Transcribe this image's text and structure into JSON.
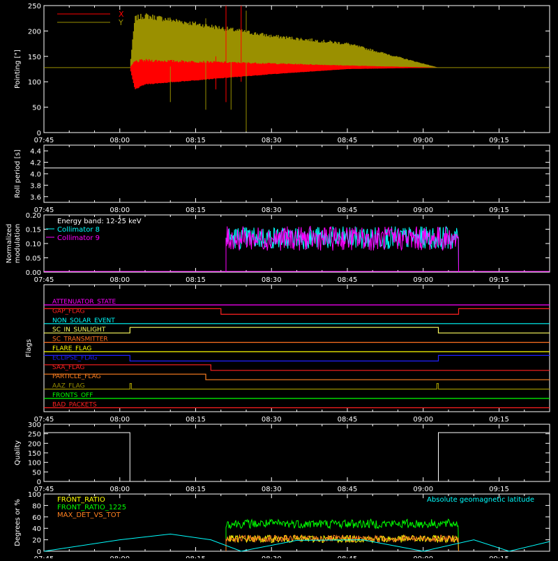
{
  "time_ticks": [
    "07:45",
    "08:00",
    "08:15",
    "08:30",
    "08:45",
    "09:00",
    "09:15"
  ],
  "panels": [
    {
      "id": "pointing",
      "ylabel": "Pointing [\"]",
      "yticks": [
        "0",
        "50",
        "100",
        "150",
        "200",
        "250"
      ],
      "ylim": [
        0,
        250
      ]
    },
    {
      "id": "roll",
      "ylabel": "Roll period [s]",
      "yticks": [
        "3.6",
        "3.8",
        "4.0",
        "4.2",
        "4.4"
      ],
      "ylim": [
        3.5,
        4.5
      ]
    },
    {
      "id": "modulation",
      "ylabel": "Normalized modulation",
      "ylabel_lines": [
        "Normalized",
        "modulation"
      ],
      "yticks": [
        "0.00",
        "0.05",
        "0.10",
        "0.15",
        "0.20"
      ],
      "ylim": [
        0,
        0.2
      ]
    },
    {
      "id": "flags",
      "ylabel": "Flags"
    },
    {
      "id": "quality",
      "ylabel": "Quality",
      "yticks": [
        "0",
        "50",
        "100",
        "150",
        "200",
        "250",
        "300"
      ],
      "ylim": [
        0,
        300
      ]
    },
    {
      "id": "latitude",
      "ylabel": "Degrees or %",
      "yticks": [
        "0",
        "20",
        "40",
        "60",
        "80",
        "100"
      ],
      "ylim": [
        0,
        100
      ]
    }
  ],
  "pointing_legend": [
    {
      "name": "X",
      "color": "#ff0000"
    },
    {
      "name": "Y",
      "color": "#9a9000"
    }
  ],
  "modulation_legend": {
    "title": "Energy band: 12-25 keV",
    "items": [
      {
        "name": "Collimator 8",
        "color": "#00ffff"
      },
      {
        "name": "Collimator 9",
        "color": "#ff00ff"
      }
    ]
  },
  "flags": [
    {
      "name": "ATTENUATOR_STATE",
      "color": "#ff00ff"
    },
    {
      "name": "GAP_FLAG",
      "color": "#ff2020"
    },
    {
      "name": "NON_SOLAR_EVENT",
      "color": "#00ffff"
    },
    {
      "name": "SC_IN_SUNLIGHT",
      "color": "#ffff60"
    },
    {
      "name": "SC_TRANSMITTER",
      "color": "#ff7020"
    },
    {
      "name": "FLARE_FLAG",
      "color": "#ffff00"
    },
    {
      "name": "ECLIPSE_FLAG",
      "color": "#2020ff"
    },
    {
      "name": "SAA_FLAG",
      "color": "#ff2020"
    },
    {
      "name": "PARTICLE_FLAG",
      "color": "#ff8020"
    },
    {
      "name": "AAZ_FLAG",
      "color": "#9a9000"
    },
    {
      "name": "FRONTS_OFF",
      "color": "#00ff00"
    },
    {
      "name": "BAD_PACKETS",
      "color": "#ff2020"
    }
  ],
  "latitude_legend": [
    {
      "name": "FRONT_RATIO",
      "color": "#ffff00"
    },
    {
      "name": "FRONT_RATIO_1225",
      "color": "#00ff00"
    },
    {
      "name": "MAX_DET_VS_TOT",
      "color": "#ff8020"
    }
  ],
  "latitude_label": {
    "text": "Absolute geomagnetic latitude",
    "color": "#00ffff"
  },
  "chart_data": [
    {
      "type": "line",
      "title": "",
      "xlabel": "",
      "ylabel": "Pointing [\"]",
      "xlim": [
        "07:45",
        "09:25"
      ],
      "ylim": [
        0,
        250
      ],
      "series": [
        {
          "name": "X",
          "color": "#ff0000",
          "x": [
            "07:45",
            "08:02",
            "08:03",
            "08:05",
            "08:30",
            "08:45",
            "09:03",
            "09:25"
          ],
          "y_low": [
            128,
            128,
            85,
            95,
            115,
            125,
            128,
            128
          ],
          "y_high": [
            128,
            128,
            140,
            142,
            136,
            132,
            128,
            128
          ]
        },
        {
          "name": "Y",
          "color": "#9a9000",
          "x": [
            "07:45",
            "08:02",
            "08:03",
            "08:05",
            "08:30",
            "08:45",
            "09:03",
            "09:25"
          ],
          "y_low": [
            128,
            128,
            130,
            130,
            128,
            126,
            128,
            128
          ],
          "y_high": [
            128,
            128,
            225,
            230,
            190,
            175,
            128,
            128
          ]
        }
      ]
    },
    {
      "type": "line",
      "title": "",
      "xlabel": "",
      "ylabel": "Roll period [s]",
      "xlim": [
        "07:45",
        "09:25"
      ],
      "ylim": [
        3.5,
        4.5
      ],
      "series": [
        {
          "x": [
            "07:45",
            "09:25"
          ],
          "y": [
            4.1,
            4.1
          ],
          "color": "#ffffff"
        }
      ]
    },
    {
      "type": "line",
      "title": "",
      "xlabel": "",
      "ylabel": "Normalized modulation",
      "xlim": [
        "07:45",
        "09:25"
      ],
      "ylim": [
        0,
        0.2
      ],
      "series": [
        {
          "name": "Collimator 8",
          "color": "#00ffff",
          "x_start": "08:21",
          "x_end": "09:07",
          "mean": 0.105,
          "min": 0.08,
          "max": 0.16
        },
        {
          "name": "Collimator 9",
          "color": "#ff00ff",
          "x_start": "08:21",
          "x_end": "09:07",
          "mean": 0.1,
          "min": 0.075,
          "max": 0.16
        }
      ]
    },
    {
      "type": "line",
      "title": "",
      "xlabel": "",
      "ylabel": "Flags",
      "xlim": [
        "07:45",
        "09:25"
      ],
      "series": [
        {
          "name": "ATTENUATOR_STATE",
          "steps": [
            [
              "07:45",
              0
            ]
          ]
        },
        {
          "name": "GAP_FLAG",
          "steps": [
            [
              "07:45",
              1
            ],
            [
              "08:20",
              0
            ],
            [
              "09:07",
              1
            ]
          ]
        },
        {
          "name": "NON_SOLAR_EVENT",
          "steps": [
            [
              "07:45",
              0
            ]
          ]
        },
        {
          "name": "SC_IN_SUNLIGHT",
          "steps": [
            [
              "07:45",
              0
            ],
            [
              "08:02",
              1
            ],
            [
              "09:03",
              0
            ]
          ]
        },
        {
          "name": "SC_TRANSMITTER",
          "steps": [
            [
              "07:45",
              0
            ]
          ]
        },
        {
          "name": "FLARE_FLAG",
          "steps": [
            [
              "07:45",
              0
            ]
          ]
        },
        {
          "name": "ECLIPSE_FLAG",
          "steps": [
            [
              "07:45",
              1
            ],
            [
              "08:02",
              0
            ],
            [
              "09:03",
              1
            ]
          ]
        },
        {
          "name": "SAA_FLAG",
          "steps": [
            [
              "07:45",
              1
            ],
            [
              "08:18",
              0
            ]
          ]
        },
        {
          "name": "PARTICLE_FLAG",
          "steps": [
            [
              "07:45",
              1
            ],
            [
              "08:17",
              0
            ]
          ]
        },
        {
          "name": "AAZ_FLAG",
          "steps": [
            [
              "07:45",
              0
            ],
            [
              "08:02",
              1
            ],
            [
              "08:02.3",
              0
            ],
            [
              "09:02.7",
              1
            ],
            [
              "09:03",
              0
            ]
          ]
        },
        {
          "name": "FRONTS_OFF",
          "steps": [
            [
              "07:45",
              0
            ]
          ]
        },
        {
          "name": "BAD_PACKETS",
          "steps": [
            [
              "07:45",
              0
            ]
          ]
        }
      ]
    },
    {
      "type": "line",
      "title": "",
      "xlabel": "",
      "ylabel": "Quality",
      "xlim": [
        "07:45",
        "09:25"
      ],
      "ylim": [
        0,
        300
      ],
      "series": [
        {
          "color": "#ffffff",
          "steps": [
            [
              "07:45",
              256
            ],
            [
              "08:02",
              0
            ],
            [
              "09:03",
              256
            ]
          ]
        }
      ]
    },
    {
      "type": "line",
      "title": "",
      "xlabel": "",
      "ylabel": "Degrees or %",
      "xlim": [
        "07:45",
        "09:25"
      ],
      "ylim": [
        0,
        100
      ],
      "series": [
        {
          "name": "FRONT_RATIO",
          "color": "#ffff00",
          "x_start": "08:21",
          "x_end": "09:07",
          "mean": 20,
          "min": 15,
          "max": 28
        },
        {
          "name": "FRONT_RATIO_1225",
          "color": "#00ff00",
          "x_start": "08:21",
          "x_end": "09:07",
          "mean": 47,
          "min": 40,
          "max": 56
        },
        {
          "name": "MAX_DET_VS_TOT",
          "color": "#ff8020",
          "x_start": "08:21",
          "x_end": "09:07",
          "mean": 22,
          "min": 16,
          "max": 28
        },
        {
          "name": "Absolute geomagnetic latitude",
          "color": "#00ffff",
          "x": [
            "07:45",
            "08:00",
            "08:10",
            "08:18",
            "08:24",
            "08:35",
            "08:48",
            "09:00",
            "09:10",
            "09:17",
            "09:25"
          ],
          "y": [
            0,
            20,
            30,
            20,
            0,
            19,
            20,
            0,
            20,
            0,
            17
          ]
        }
      ]
    }
  ]
}
